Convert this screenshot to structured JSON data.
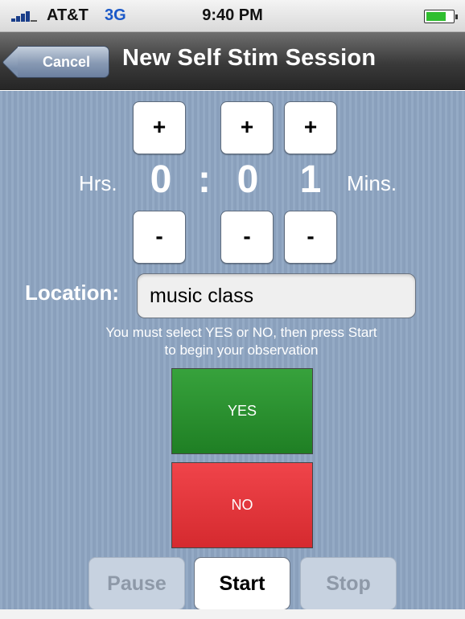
{
  "status_bar": {
    "carrier": "AT&T",
    "network": "3G",
    "time": "9:40 PM"
  },
  "nav": {
    "back_label": "Cancel",
    "title": "New Self Stim Session"
  },
  "timer": {
    "hours_label": "Hrs.",
    "minutes_label": "Mins.",
    "hours_digit": "0",
    "separator": ":",
    "minutes_tens_digit": "0",
    "minutes_ones_digit": "1",
    "increment_label": "+",
    "decrement_label": "-"
  },
  "location": {
    "label": "Location:",
    "value": "music class"
  },
  "instructions": {
    "line1": "You must select YES or NO, then press Start",
    "line2": "to begin your observation"
  },
  "choices": {
    "yes_label": "YES",
    "no_label": "NO",
    "yes_color": "#2e9234",
    "no_color": "#e5373c"
  },
  "controls": {
    "pause_label": "Pause",
    "start_label": "Start",
    "stop_label": "Stop"
  },
  "colors": {
    "background": "#8ea5c2",
    "nav_bar": "#3a3a3a"
  }
}
